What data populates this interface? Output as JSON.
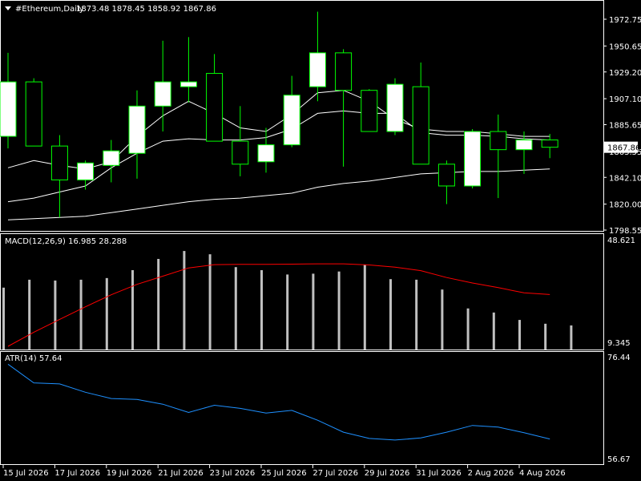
{
  "colors": {
    "background": "#000000",
    "bull_body": "#ffffff",
    "bear_body": "#000000",
    "candle_outline": "#00ff00",
    "ma_line": "#ffffff",
    "macd_hist": "#c0c0c0",
    "macd_signal": "#ff0000",
    "atr_line": "#1e90ff",
    "price_tag_bg": "#ffffff",
    "price_tag_text": "#000000"
  },
  "header": {
    "symbol": "#Ethereum,Daily",
    "ohlc": "1873.48 1878.45 1858.92 1867.86",
    "menu_icon": "triangle-down"
  },
  "price_axis": {
    "ticks": [
      "1972.75",
      "1950.65",
      "1929.20",
      "1907.10",
      "1885.65",
      "1863.55",
      "1842.10",
      "1820.00",
      "1798.55"
    ],
    "current_price_label": "1867.86"
  },
  "macd": {
    "label": "MACD(12,26,9) 16.985 28.288",
    "axis_top": "48.621",
    "axis_bottom": "9.345"
  },
  "atr": {
    "label": "ATR(14) 57.64",
    "axis_top": "76.44",
    "axis_bottom": "56.67"
  },
  "date_axis": {
    "ticks": [
      "15 Jul 2026",
      "17 Jul 2026",
      "19 Jul 2026",
      "21 Jul 2026",
      "23 Jul 2026",
      "25 Jul 2026",
      "27 Jul 2026",
      "29 Jul 2026",
      "31 Jul 2026",
      "2 Aug 2026",
      "4 Aug 2026"
    ]
  },
  "chart_data": [
    {
      "type": "candlestick",
      "title": "#Ethereum,Daily",
      "ylim": [
        1798.55,
        1985.0
      ],
      "x_dates": [
        "15 Jul 2026",
        "15 Jul 2026",
        "16 Jul 2026",
        "17 Jul 2026",
        "17 Jul 2026",
        "18 Jul 2026",
        "19 Jul 2026",
        "19 Jul 2026",
        "20 Jul 2026",
        "21 Jul 2026",
        "21 Jul 2026",
        "22 Jul 2026",
        "23 Jul 2026",
        "23 Jul 2026",
        "24 Jul 2026",
        "25 Jul 2026",
        "25 Jul 2026",
        "26 Jul 2026",
        "27 Jul 2026",
        "27 Jul 2026",
        "28 Jul 2026",
        "29 Jul 2026",
        "29 Jul 2026",
        "30 Jul 2026",
        "31 Jul 2026",
        "31 Jul 2026",
        "1 Aug 2026",
        "2 Aug 2026",
        "2 Aug 2026",
        "3 Aug 2026",
        "4 Aug 2026",
        "4 Aug 2026",
        "5 Aug 2026"
      ],
      "candles": [
        {
          "o": 1876,
          "h": 1945,
          "l": 1866,
          "c": 1921
        },
        {
          "o": 1921,
          "h": 1924,
          "l": 1868,
          "c": 1868
        },
        {
          "o": 1868,
          "h": 1877,
          "l": 1809,
          "c": 1840
        },
        {
          "o": 1840,
          "h": 1856,
          "l": 1832,
          "c": 1854
        },
        {
          "o": 1852,
          "h": 1873,
          "l": 1838,
          "c": 1864
        },
        {
          "o": 1862,
          "h": 1914,
          "l": 1841,
          "c": 1901
        },
        {
          "o": 1901,
          "h": 1955,
          "l": 1880,
          "c": 1921
        },
        {
          "o": 1917,
          "h": 1958,
          "l": 1904,
          "c": 1921
        },
        {
          "o": 1928,
          "h": 1944,
          "l": 1876,
          "c": 1872
        },
        {
          "o": 1872,
          "h": 1901,
          "l": 1843,
          "c": 1853
        },
        {
          "o": 1855,
          "h": 1883,
          "l": 1846,
          "c": 1869
        },
        {
          "o": 1869,
          "h": 1926,
          "l": 1867,
          "c": 1910
        },
        {
          "o": 1917,
          "h": 1979,
          "l": 1905,
          "c": 1945
        },
        {
          "o": 1945,
          "h": 1948,
          "l": 1851,
          "c": 1914
        },
        {
          "o": 1914,
          "h": 1915,
          "l": 1880,
          "c": 1880
        },
        {
          "o": 1880,
          "h": 1924,
          "l": 1877,
          "c": 1919
        },
        {
          "o": 1917,
          "h": 1937,
          "l": 1854,
          "c": 1853
        },
        {
          "o": 1853,
          "h": 1856,
          "l": 1820,
          "c": 1835
        },
        {
          "o": 1835,
          "h": 1882,
          "l": 1833,
          "c": 1880
        },
        {
          "o": 1880,
          "h": 1894,
          "l": 1825,
          "c": 1865
        },
        {
          "o": 1865,
          "h": 1880,
          "l": 1845,
          "c": 1873
        },
        {
          "o": 1873,
          "h": 1878,
          "l": 1858,
          "c": 1867
        }
      ],
      "moving_averages": [
        {
          "values": [
            1850,
            1856,
            1852,
            1849,
            1855,
            1876,
            1893,
            1905,
            1895,
            1883,
            1880,
            1894,
            1912,
            1914,
            1905,
            1890,
            1882,
            1880,
            1880,
            1878,
            1876,
            1876
          ]
        },
        {
          "values": [
            1822,
            1825,
            1830,
            1835,
            1850,
            1862,
            1872,
            1874,
            1873,
            1873,
            1875,
            1882,
            1895,
            1897,
            1895,
            1895,
            1879,
            1877,
            1877,
            1876,
            1874,
            1873
          ]
        },
        {
          "values": [
            1807,
            1808,
            1809,
            1810,
            1813,
            1816,
            1819,
            1822,
            1824,
            1825,
            1827,
            1829,
            1834,
            1837,
            1839,
            1842,
            1845,
            1846,
            1847,
            1847,
            1848,
            1849
          ]
        }
      ]
    },
    {
      "type": "bar",
      "title": "MACD(12,26,9) 16.985 28.288",
      "ylim": [
        9.345,
        48.621
      ],
      "histogram": [
        30.8,
        33.7,
        33.4,
        33.7,
        34.3,
        37.2,
        41.3,
        44.2,
        43.0,
        38.3,
        37.2,
        35.6,
        35.9,
        36.7,
        39.1,
        33.9,
        33.7,
        30.1,
        23.2,
        21.7,
        19.0,
        17.6,
        16.985
      ],
      "signal_line": [
        9.345,
        14.5,
        19.2,
        23.8,
        28.2,
        32.0,
        35.0,
        38.0,
        39.2,
        39.3,
        39.3,
        39.4,
        39.5,
        39.5,
        39.1,
        38.3,
        37.0,
        34.5,
        32.5,
        30.8,
        28.9,
        28.288
      ]
    },
    {
      "type": "line",
      "title": "ATR(14) 57.64",
      "ylim": [
        56.67,
        76.44
      ],
      "values": [
        75.0,
        71.4,
        71.2,
        69.6,
        68.4,
        68.2,
        67.3,
        65.7,
        67.1,
        66.5,
        65.6,
        66.1,
        64.2,
        61.9,
        60.7,
        60.4,
        60.8,
        61.9,
        63.2,
        62.9,
        61.8,
        60.6
      ]
    }
  ]
}
